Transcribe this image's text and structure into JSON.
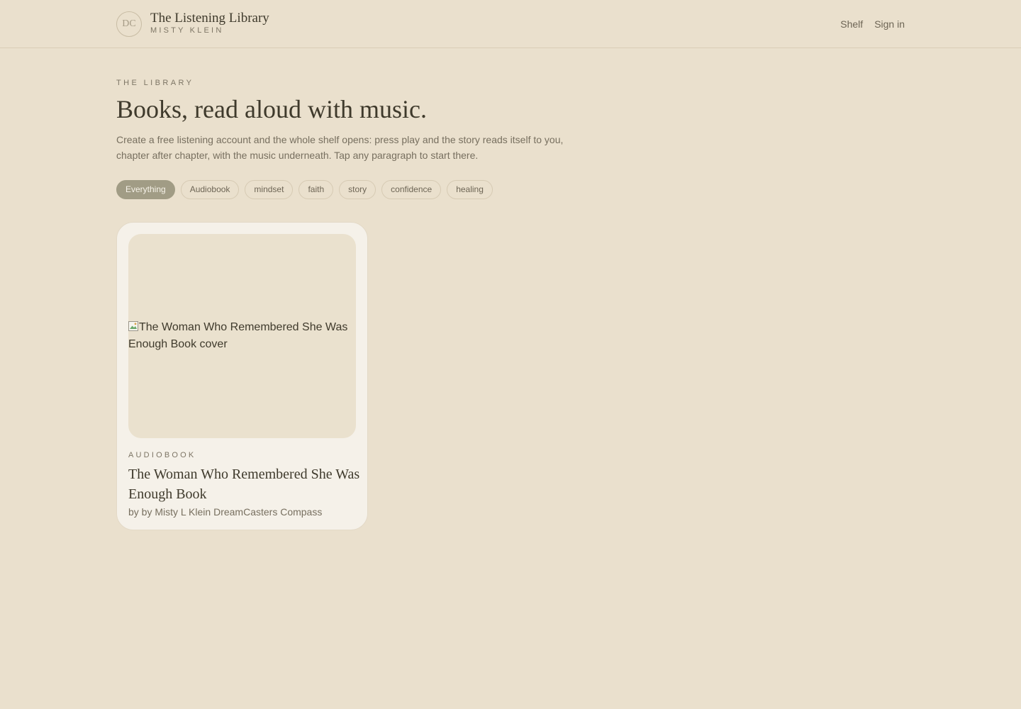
{
  "header": {
    "logo_initials": "DC",
    "title": "The Listening Library",
    "subtitle": "MISTY KLEIN",
    "nav": {
      "shelf_label": "Shelf",
      "signin_label": "Sign in"
    }
  },
  "hero": {
    "eyebrow": "THE LIBRARY",
    "headline": "Books, read aloud with music.",
    "intro": "Create a free listening account and the whole shelf opens: press play and the story reads itself to you, chapter after chapter, with the music underneath. Tap any paragraph to start there."
  },
  "filters": {
    "selected": "Everything",
    "items": [
      {
        "label": "Everything"
      },
      {
        "label": "Audiobook"
      },
      {
        "label": "mindset"
      },
      {
        "label": "faith"
      },
      {
        "label": "story"
      },
      {
        "label": "confidence"
      },
      {
        "label": "healing"
      }
    ]
  },
  "books": [
    {
      "cover_alt": "The Woman Who Remembered She Was Enough Book cover",
      "type": "AUDIOBOOK",
      "title": "The Woman Who Remembered She Was Enough Book",
      "author": "by by Misty L Klein DreamCasters Compass"
    }
  ],
  "colors": {
    "background": "#eae0cd",
    "card": "#f5f1e9",
    "active_chip": "#a19c85",
    "text_dark": "#3f3a2c",
    "text_muted": "#776f5f"
  }
}
